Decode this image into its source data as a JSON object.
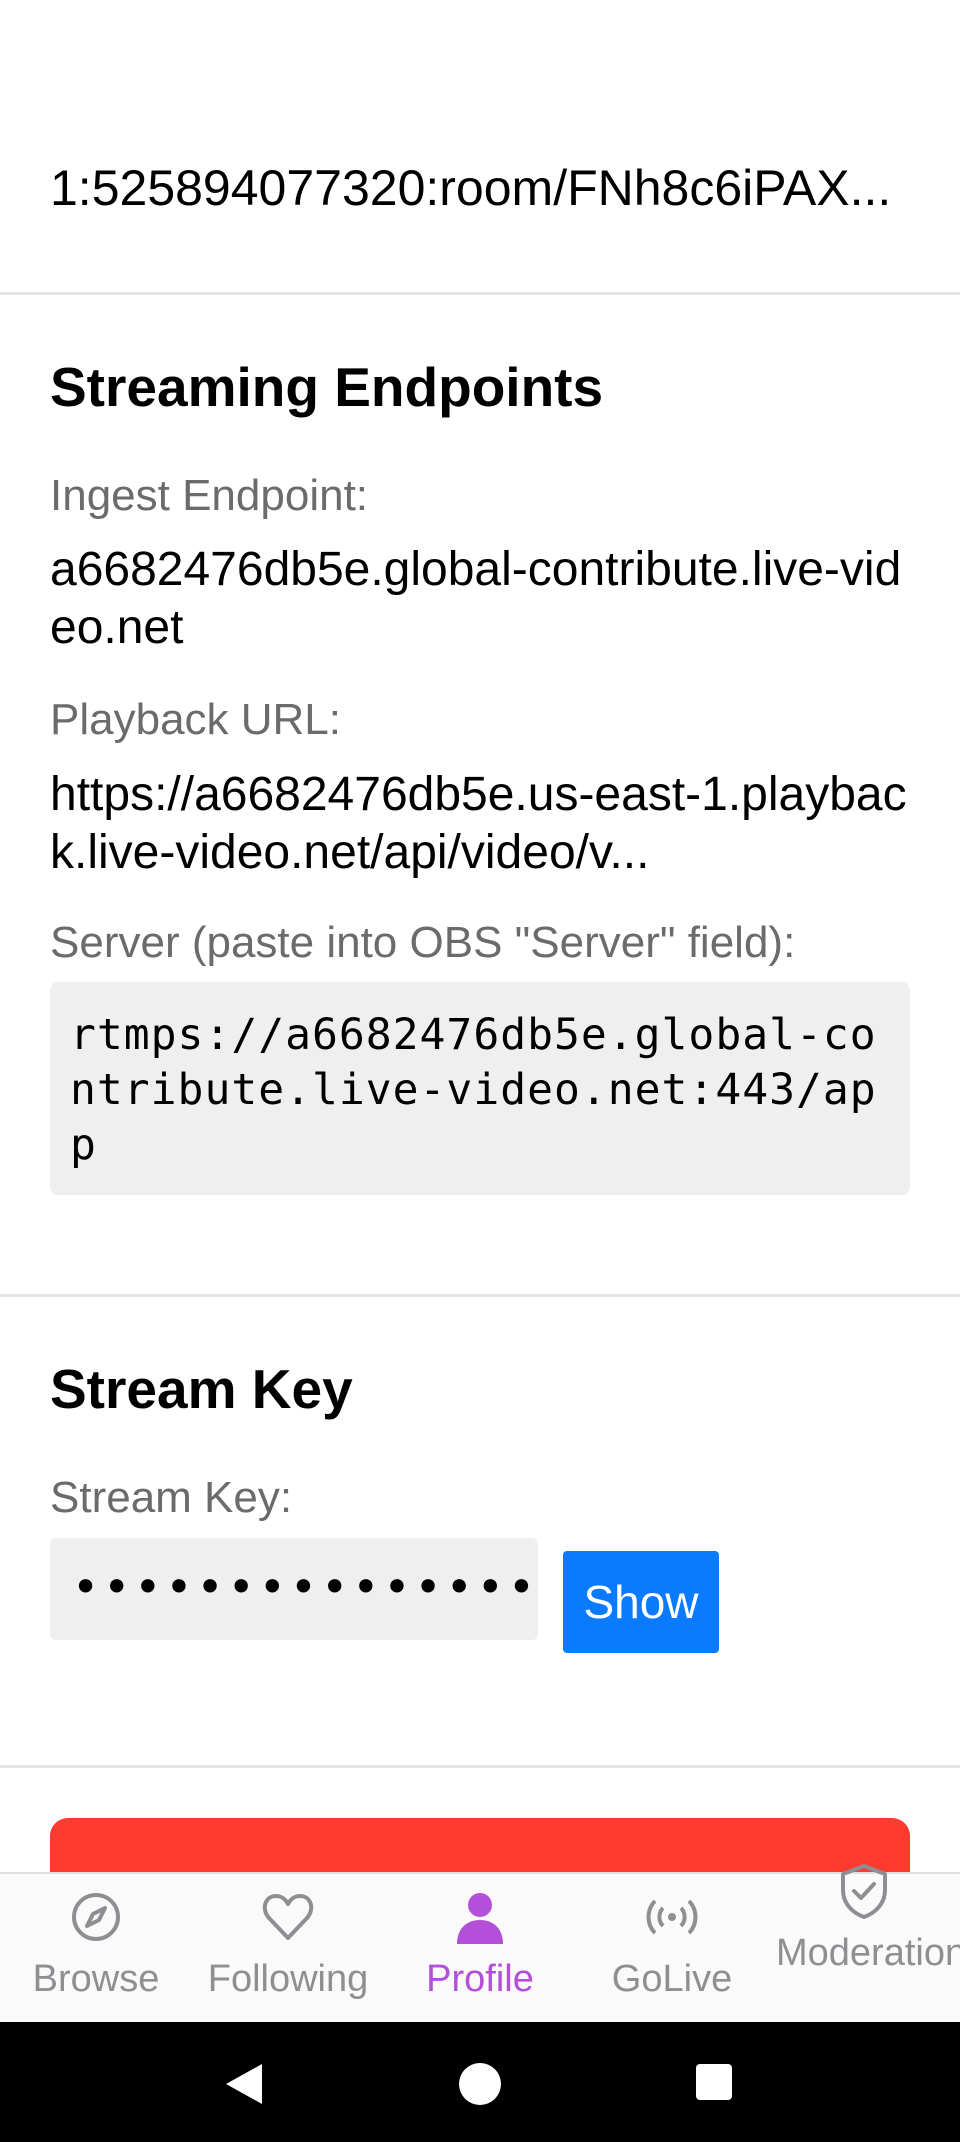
{
  "arn_value": "1:525894077320:room/FNh8c6iPAX...",
  "endpoints": {
    "title": "Streaming Endpoints",
    "ingest_label": "Ingest Endpoint:",
    "ingest_value": "a6682476db5e.global-contribute.live-video.net",
    "playback_label": "Playback URL:",
    "playback_value": "https://a6682476db5e.us-east-1.playback.live-video.net/api/video/v...",
    "server_label": "Server (paste into OBS \"Server\" field):",
    "server_value": "rtmps://a6682476db5e.global-contribute.live-video.net:443/app"
  },
  "stream_key": {
    "title": "Stream Key",
    "label": "Stream Key:",
    "masked_value": "••••••••••••••••",
    "show_label": "Show"
  },
  "tabs": [
    {
      "label": "Browse",
      "icon": "compass-icon"
    },
    {
      "label": "Following",
      "icon": "heart-icon"
    },
    {
      "label": "Profile",
      "icon": "person-icon",
      "active": true
    },
    {
      "label": "GoLive",
      "icon": "broadcast-icon"
    },
    {
      "label": "Moderation",
      "icon": "shield-check-icon"
    }
  ],
  "colors": {
    "accent": "#b44fd9",
    "button_blue": "#0a7aff",
    "danger_red": "#ff3b30",
    "inactive_tab": "#8e8e93"
  }
}
